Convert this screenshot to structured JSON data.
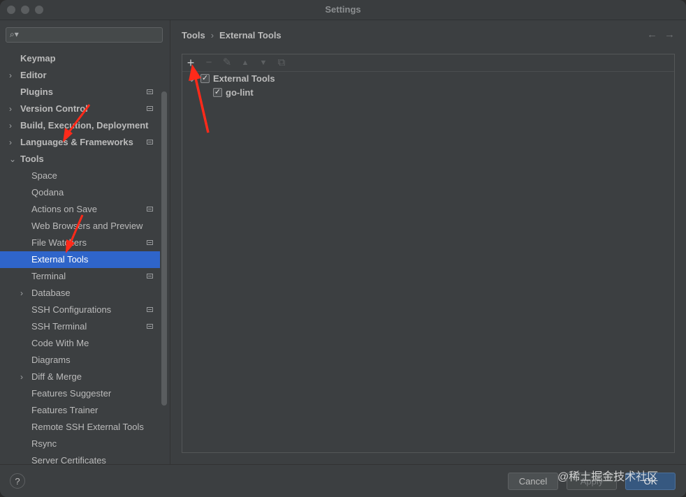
{
  "window": {
    "title": "Settings"
  },
  "sidebar": {
    "search": {
      "placeholder": "",
      "value": ""
    },
    "items": [
      {
        "label": "Keymap",
        "level": 0,
        "expander": "",
        "bold": true,
        "project": false
      },
      {
        "label": "Editor",
        "level": 0,
        "expander": ">",
        "bold": true,
        "project": false
      },
      {
        "label": "Plugins",
        "level": 0,
        "expander": "",
        "bold": true,
        "project": true
      },
      {
        "label": "Version Control",
        "level": 0,
        "expander": ">",
        "bold": true,
        "project": true
      },
      {
        "label": "Build, Execution, Deployment",
        "level": 0,
        "expander": ">",
        "bold": true,
        "project": false
      },
      {
        "label": "Languages & Frameworks",
        "level": 0,
        "expander": ">",
        "bold": true,
        "project": true
      },
      {
        "label": "Tools",
        "level": 0,
        "expander": "v",
        "bold": true,
        "project": false
      },
      {
        "label": "Space",
        "level": 1,
        "expander": "",
        "bold": false,
        "project": false
      },
      {
        "label": "Qodana",
        "level": 1,
        "expander": "",
        "bold": false,
        "project": false
      },
      {
        "label": "Actions on Save",
        "level": 1,
        "expander": "",
        "bold": false,
        "project": true
      },
      {
        "label": "Web Browsers and Preview",
        "level": 1,
        "expander": "",
        "bold": false,
        "project": false
      },
      {
        "label": "File Watchers",
        "level": 1,
        "expander": "",
        "bold": false,
        "project": true
      },
      {
        "label": "External Tools",
        "level": 1,
        "expander": "",
        "bold": false,
        "project": false,
        "selected": true
      },
      {
        "label": "Terminal",
        "level": 1,
        "expander": "",
        "bold": false,
        "project": true
      },
      {
        "label": "Database",
        "level": 1,
        "expander": ">",
        "bold": false,
        "project": false
      },
      {
        "label": "SSH Configurations",
        "level": 1,
        "expander": "",
        "bold": false,
        "project": true
      },
      {
        "label": "SSH Terminal",
        "level": 1,
        "expander": "",
        "bold": false,
        "project": true
      },
      {
        "label": "Code With Me",
        "level": 1,
        "expander": "",
        "bold": false,
        "project": false
      },
      {
        "label": "Diagrams",
        "level": 1,
        "expander": "",
        "bold": false,
        "project": false
      },
      {
        "label": "Diff & Merge",
        "level": 1,
        "expander": ">",
        "bold": false,
        "project": false
      },
      {
        "label": "Features Suggester",
        "level": 1,
        "expander": "",
        "bold": false,
        "project": false
      },
      {
        "label": "Features Trainer",
        "level": 1,
        "expander": "",
        "bold": false,
        "project": false
      },
      {
        "label": "Remote SSH External Tools",
        "level": 1,
        "expander": "",
        "bold": false,
        "project": false
      },
      {
        "label": "Rsync",
        "level": 1,
        "expander": "",
        "bold": false,
        "project": false
      },
      {
        "label": "Server Certificates",
        "level": 1,
        "expander": "",
        "bold": false,
        "project": false
      }
    ]
  },
  "main": {
    "breadcrumb": {
      "root": "Tools",
      "separator": "›",
      "current": "External Tools"
    },
    "nav": {
      "back": "←",
      "forward": "→"
    },
    "toolbar": {
      "add": "+",
      "remove": "−",
      "edit": "✎",
      "up": "▲",
      "down": "▼",
      "copy": "⧉"
    },
    "tree": [
      {
        "label": "External Tools",
        "checked": true,
        "expander": "v",
        "level": 0
      },
      {
        "label": "go-lint",
        "checked": true,
        "expander": "",
        "level": 1
      }
    ]
  },
  "footer": {
    "help": "?",
    "cancel": "Cancel",
    "apply": "Apply",
    "ok": "OK"
  },
  "watermark": "@稀土掘金技术社区",
  "colors": {
    "selection": "#2f65ca",
    "annotation_arrow": "#ff2a1a",
    "ok_button": "#365880"
  }
}
